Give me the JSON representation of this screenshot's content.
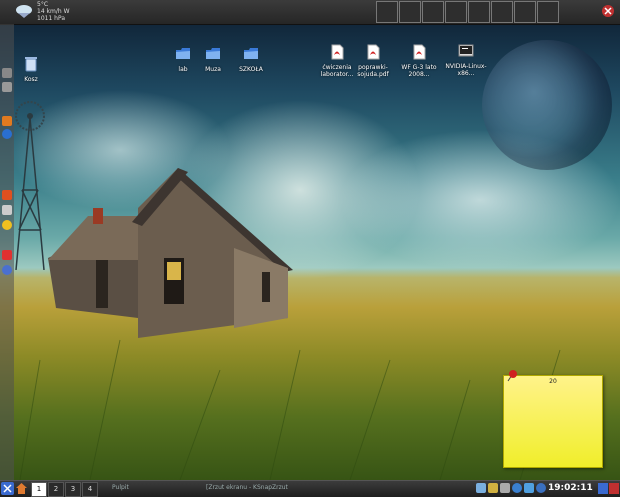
{
  "weather": {
    "line1": "5°C",
    "line2": "14 km/h W",
    "line3": "1011 hPa"
  },
  "pager_cells": 8,
  "desktop": {
    "icons": [
      {
        "name": "kosz",
        "label": "Kosz"
      },
      {
        "name": "lab",
        "label": "lab"
      },
      {
        "name": "muza",
        "label": "Muza"
      },
      {
        "name": "szkola",
        "label": "SZKOŁA"
      },
      {
        "name": "cwiczenia",
        "label": "ćwiczenia laborator..."
      },
      {
        "name": "poprawkowa",
        "label": "poprawki-sojuda.pdf"
      },
      {
        "name": "wf",
        "label": "WF G-3 lato 2008..."
      },
      {
        "name": "nvidia",
        "label": "NVIDIA-Linux-x86..."
      }
    ]
  },
  "note": {
    "title": "20"
  },
  "taskbar": {
    "workspaces": [
      "1",
      "2",
      "3",
      "4"
    ],
    "tasks": [
      "Pulpit",
      "[Zrzut ekranu - KSnap...",
      "Zrzut"
    ],
    "clock": "19:02:11"
  },
  "colors": {
    "panel": "#2e2e2e",
    "note": "#f5f04a",
    "accent": "#e03030"
  }
}
